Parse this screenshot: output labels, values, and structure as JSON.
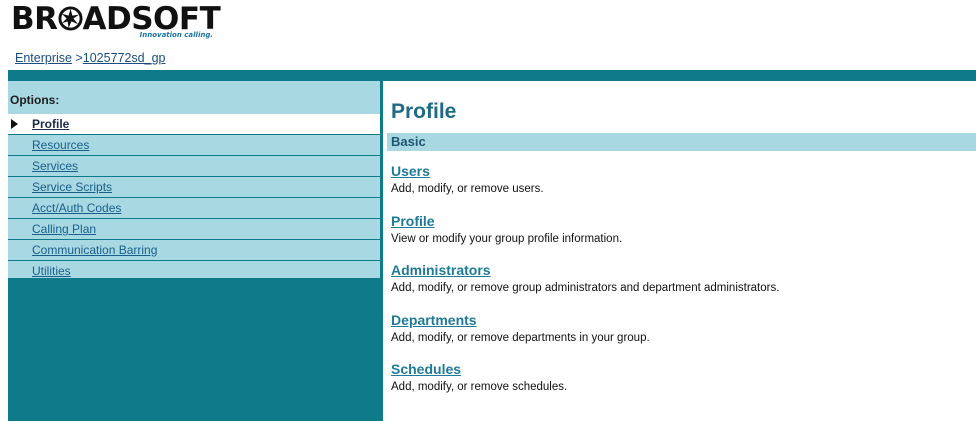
{
  "header": {
    "logo_text": "BROADSOFT",
    "logo_tagline": "Innovation calling.",
    "breadcrumb": {
      "root": "Enterprise",
      "separator": " >",
      "current": "1025772sd_gp"
    }
  },
  "sidebar": {
    "title": "Options:",
    "items": [
      {
        "label": "Profile",
        "active": true
      },
      {
        "label": "Resources"
      },
      {
        "label": "Services"
      },
      {
        "label": "Service Scripts"
      },
      {
        "label": "Acct/Auth Codes"
      },
      {
        "label": "Calling Plan"
      },
      {
        "label": "Communication Barring"
      },
      {
        "label": "Utilities"
      }
    ]
  },
  "main": {
    "title": "Profile",
    "section": "Basic",
    "items": [
      {
        "title": "Users",
        "description": "Add, modify, or remove users."
      },
      {
        "title": "Profile",
        "description": "View or modify your group profile information."
      },
      {
        "title": "Administrators",
        "description": "Add, modify, or remove group administrators and department administrators."
      },
      {
        "title": "Departments",
        "description": "Add, modify, or remove departments in your group."
      },
      {
        "title": "Schedules",
        "description": "Add, modify, or remove schedules."
      }
    ]
  },
  "colors": {
    "teal": "#0f7b8a",
    "light_blue": "#a8d8e2",
    "link": "#1f7a9a"
  }
}
